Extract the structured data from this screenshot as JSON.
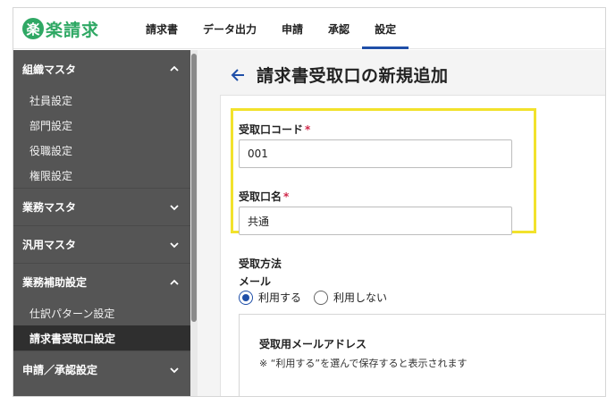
{
  "app": {
    "logo_glyph": "楽",
    "logo_text": "楽請求",
    "brand_color": "#2fa864",
    "accent_color": "#1f4fa8"
  },
  "nav": {
    "items": [
      {
        "label": "請求書",
        "active": false
      },
      {
        "label": "データ出力",
        "active": false
      },
      {
        "label": "申請",
        "active": false
      },
      {
        "label": "承認",
        "active": false
      },
      {
        "label": "設定",
        "active": true
      }
    ]
  },
  "sidebar": {
    "sections": [
      {
        "label": "組織マスタ",
        "expanded": true,
        "icon": "chevron-up-icon",
        "items": [
          {
            "label": "社員設定"
          },
          {
            "label": "部門設定"
          },
          {
            "label": "役職設定"
          },
          {
            "label": "権限設定"
          }
        ]
      },
      {
        "label": "業務マスタ",
        "expanded": false,
        "icon": "chevron-down-icon",
        "items": []
      },
      {
        "label": "汎用マスタ",
        "expanded": false,
        "icon": "chevron-down-icon",
        "items": []
      },
      {
        "label": "業務補助設定",
        "expanded": true,
        "icon": "chevron-up-icon",
        "items": [
          {
            "label": "仕訳パターン設定",
            "active": false
          },
          {
            "label": "請求書受取口設定",
            "active": true
          }
        ]
      },
      {
        "label": "申請／承認設定",
        "expanded": false,
        "icon": "chevron-down-icon",
        "items": []
      }
    ]
  },
  "main": {
    "title": "請求書受取口の新規追加",
    "back_icon": "arrow-left-icon",
    "form": {
      "code_label": "受取口コード",
      "code_required": "*",
      "code_value": "001",
      "name_label": "受取口名",
      "name_required": "*",
      "name_value": "共通",
      "method_label": "受取方法",
      "mail_label": "メール",
      "radio_use": "利用する",
      "radio_no_use": "利用しない",
      "radio_selected": "利用する",
      "email_title": "受取用メールアドレス",
      "email_note": "※ “利用する”を選んで保存すると表示されます"
    }
  }
}
